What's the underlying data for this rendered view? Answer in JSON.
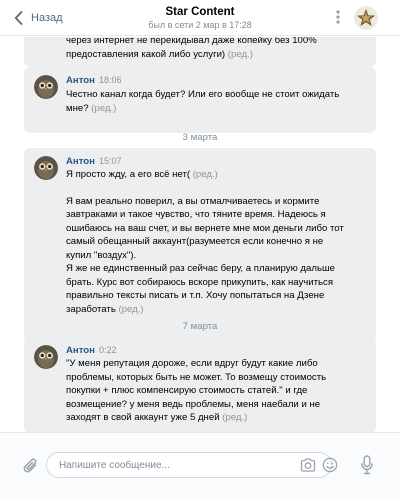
{
  "header": {
    "back_label": "Назад",
    "title": "Star Content",
    "status": "был в сети 2 мар в 17:28"
  },
  "messages": [
    {
      "lines": [
        "через интернет не перекидывал даже копейку без 100%",
        "предоставления какой либо услуги)"
      ],
      "edited": " (ред.)"
    },
    {
      "author": "Антон",
      "time": "18:06",
      "lines": [
        "Честно канал когда будет? Или его вообще не стоит ожидать",
        "мне?"
      ],
      "edited": " (ред.)"
    },
    {
      "date": "3 марта"
    },
    {
      "author": "Антон",
      "time": "15:07",
      "first_line": "Я просто жду, а его всё нет(",
      "first_edited": " (ред.)",
      "lines": [
        "Я вам реально поверил, а вы отмалчиваетесь и кормите",
        "завтраками и такое чувство, что тяните время. Надеюсь я",
        "ошибаюсь на ваш счет, и вы вернете мне мои деньги либо тот",
        "самый обещанный аккаунт(разумеется если конечно я не",
        "купил \"воздух\").",
        "Я же не единственный раз сейчас беру, а планирую дальше",
        "брать. Курс вот собираюсь вскоре прикупить, как научиться",
        "правильно тексты писать и т.п. Хочу попытаться на Дзене",
        "заработать"
      ],
      "edited": " (ред.)"
    },
    {
      "date": "7 марта"
    },
    {
      "author": "Антон",
      "time": "0:22",
      "lines": [
        "\"У меня репутация дороже, если вдруг будут какие либо",
        "проблемы, которых быть не может. То возмещу стоимость",
        "покупки + плюс компенсирую стоимость статей.\" и где",
        "возмещение? у меня ведь проблемы, меня наебали и не",
        "заходят в свой аккаунт уже 5 дней"
      ],
      "edited": " (ред.)"
    }
  ],
  "composer": {
    "placeholder": "Напишите сообщение..."
  },
  "icons": {
    "back": "chevron-left-icon",
    "more": "more-dots-icon",
    "attach": "paperclip-icon",
    "camera": "camera-icon",
    "smile": "smile-icon",
    "mic": "microphone-icon"
  },
  "colors": {
    "accent": "#2a5885",
    "bubble": "#edeef0",
    "meta": "#939393",
    "icon": "#99a2ad"
  }
}
